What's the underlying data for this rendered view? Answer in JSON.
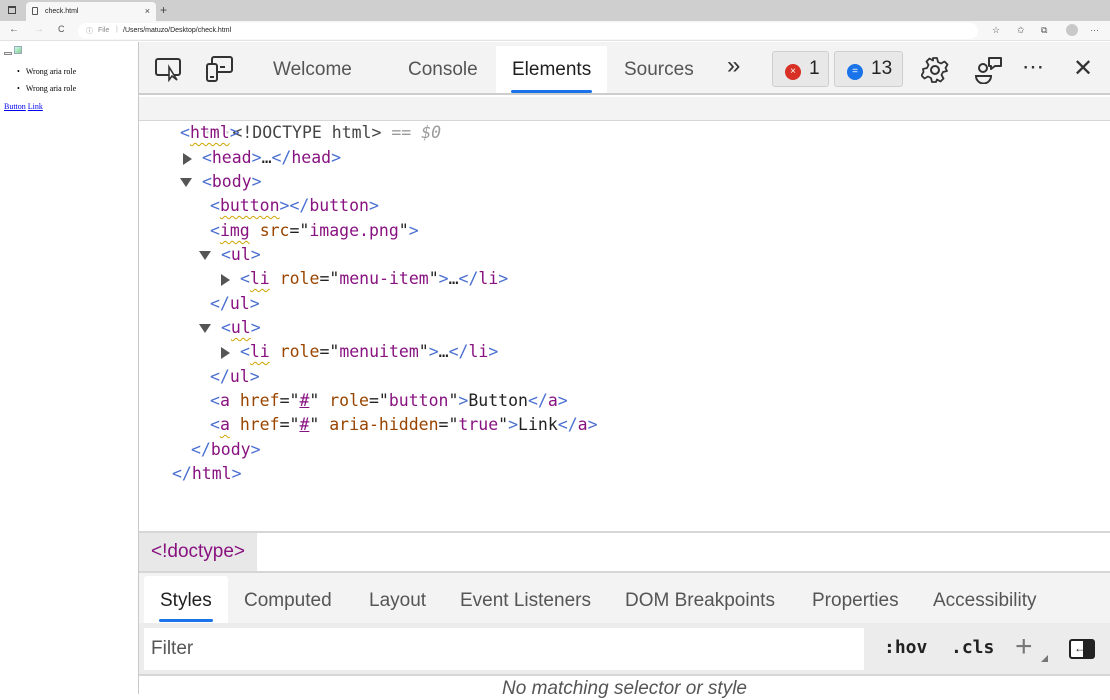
{
  "browser": {
    "tab_title": "check.html",
    "tab_close": "×",
    "new_tab": "+",
    "back": "←",
    "forward": "→",
    "reload": "C",
    "info_icon": "ⓘ",
    "scheme_label": "File",
    "separator": "|",
    "url": "/Users/matuzo/Desktop/check.html",
    "more": "···"
  },
  "page": {
    "list_items": [
      "Wrong aria role",
      "Wrong aria role"
    ],
    "link_button": "Button",
    "link_link": "Link"
  },
  "devtools": {
    "tabs": [
      {
        "label": "Welcome",
        "active": false
      },
      {
        "label": "Console",
        "active": false
      },
      {
        "label": "Elements",
        "active": true
      },
      {
        "label": "Sources",
        "active": false
      }
    ],
    "more_tabs": "»",
    "error_count": "1",
    "message_count": "13",
    "error_badge_color": "#d93025",
    "message_badge_color": "#1a73e8",
    "more_menu": "⋯",
    "close": "✕"
  },
  "dom": {
    "doctype": "<!DOCTYPE html>",
    "eq": "==",
    "dollar": "$0",
    "lines": {
      "html_open": "html",
      "head": "head",
      "ellipsis": "…",
      "body": "body",
      "button": "button",
      "img": "img",
      "img_attr": "src",
      "img_val": "image.png",
      "ul": "ul",
      "li": "li",
      "role_attr": "role",
      "li1_val": "menu-item",
      "li2_val": "menuitem",
      "a": "a",
      "href_attr": "href",
      "href_val": "#",
      "a1_attr2": "role",
      "a1_val2": "button",
      "a1_text": "Button",
      "a2_attr2": "aria-hidden",
      "a2_val2": "true",
      "a2_text": "Link"
    }
  },
  "breadcrumb": "<!doctype>",
  "subtabs": [
    {
      "label": "Styles",
      "active": true
    },
    {
      "label": "Computed",
      "active": false
    },
    {
      "label": "Layout",
      "active": false
    },
    {
      "label": "Event Listeners",
      "active": false
    },
    {
      "label": "DOM Breakpoints",
      "active": false
    },
    {
      "label": "Properties",
      "active": false
    },
    {
      "label": "Accessibility",
      "active": false
    }
  ],
  "styles": {
    "filter_placeholder": "Filter",
    "hov": ":hov",
    "cls": ".cls",
    "new_rule": "+",
    "toggle_sidebar": "←",
    "no_match": "No matching selector or style"
  }
}
